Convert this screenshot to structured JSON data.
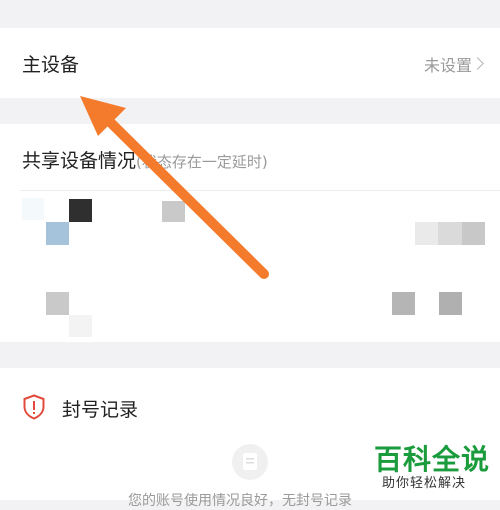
{
  "primary_device": {
    "label": "主设备",
    "value": "未设置"
  },
  "shared_devices": {
    "title": "共享设备情况",
    "note": "(状态存在一定延时)"
  },
  "ban_record": {
    "label": "封号记录",
    "empty_text": "您的账号使用情况良好，无封号记录"
  },
  "colors": {
    "accent_arrow": "#f47a2c",
    "shield_red": "#e24a3b",
    "watermark_green": "#1a9b3c"
  },
  "watermark": {
    "title": "百科全说",
    "subtitle": "助你轻松解决"
  },
  "icons": [
    "chevron-right-icon",
    "shield-alert-icon",
    "document-icon",
    "arrow-annotation-icon"
  ]
}
